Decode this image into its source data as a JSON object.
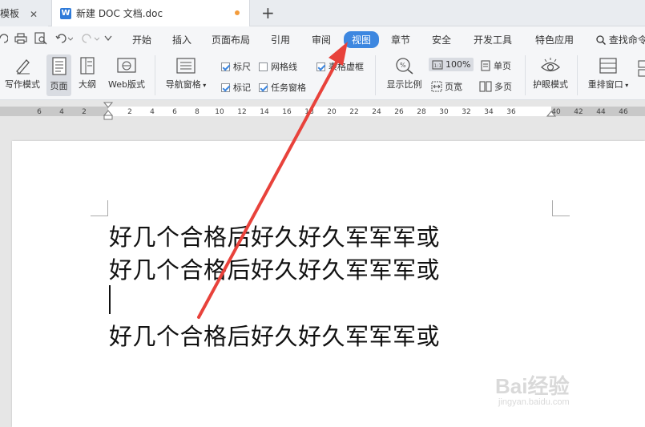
{
  "tabs": {
    "tab1_label": "模板",
    "tab2_label": "新建 DOC 文档.doc",
    "doc_icon_letter": "W"
  },
  "menu": {
    "items": [
      "开始",
      "插入",
      "页面布局",
      "引用",
      "审阅",
      "视图",
      "章节",
      "安全",
      "开发工具",
      "特色应用"
    ],
    "active": "视图",
    "search": "查找命令"
  },
  "ribbon": {
    "write_mode": "写作模式",
    "page": "页面",
    "outline": "大纲",
    "web": "Web版式",
    "nav_pane": "导航窗格",
    "ruler": "标尺",
    "gridlines": "网格线",
    "table_gridlines": "表格虚框",
    "marks": "标记",
    "task_pane": "任务窗格",
    "zoom_ratio": "显示比例",
    "zoom_value": "100%",
    "page_width": "页宽",
    "single_page": "单页",
    "multi_page": "多页",
    "eye_mode": "护眼模式",
    "rearrange": "重排窗口"
  },
  "ruler_ticks": [
    "6",
    "4",
    "2",
    "2",
    "4",
    "6",
    "8",
    "10",
    "12",
    "14",
    "16",
    "18",
    "20",
    "22",
    "24",
    "26",
    "28",
    "30",
    "32",
    "34",
    "36",
    "40",
    "42",
    "44",
    "46"
  ],
  "document": {
    "lines": [
      "好几个合格后好久好久军军军或",
      "好几个合格后好久好久军军军或",
      "好几个合格后好久好久军军军或"
    ]
  },
  "watermark": {
    "brand": "Bai经验",
    "url": "jingyan.baidu.com"
  },
  "colors": {
    "accent": "#3d87e0",
    "arrow": "#e8423b",
    "modified_dot": "#f39c3b"
  }
}
